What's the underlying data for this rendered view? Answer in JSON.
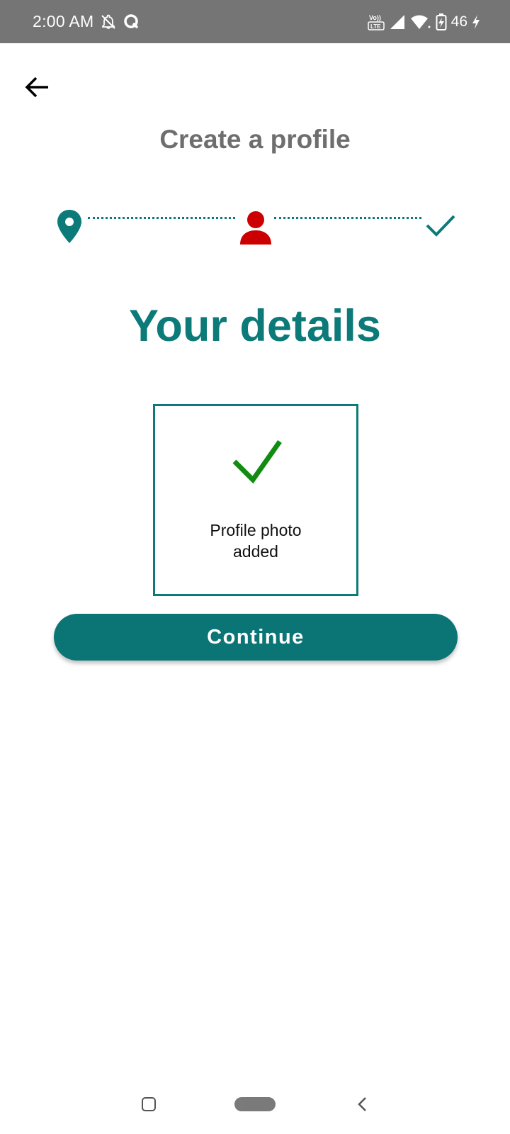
{
  "status_bar": {
    "time": "2:00 AM",
    "battery_level": "46",
    "icons": [
      "notifications-off-icon",
      "q-app-icon",
      "volte-icon",
      "cell-signal-icon",
      "wifi-icon",
      "battery-icon",
      "charging-bolt-icon"
    ]
  },
  "header": {
    "title": "Create a profile",
    "back_icon": "arrow-left-icon"
  },
  "stepper": {
    "steps": [
      {
        "icon": "location-pin-icon",
        "state": "completed",
        "color": "#0b7a78"
      },
      {
        "icon": "person-icon",
        "state": "current",
        "color": "#cc0000"
      },
      {
        "icon": "checkmark-icon",
        "state": "upcoming",
        "color": "#0b7a78"
      }
    ]
  },
  "main": {
    "heading": "Your details",
    "photo_box": {
      "icon": "checkmark-icon",
      "label_line1": "Profile photo",
      "label_line2": "added"
    },
    "continue_label": "Continue"
  },
  "nav_bar": {
    "items": [
      "recents-button",
      "home-button",
      "back-button"
    ]
  },
  "colors": {
    "accent": "#0b7a78",
    "button": "#0b7576",
    "current_step": "#cc0000",
    "success_check": "#118c11",
    "title_gray": "#6e6e6e",
    "status_bar": "#757575"
  }
}
